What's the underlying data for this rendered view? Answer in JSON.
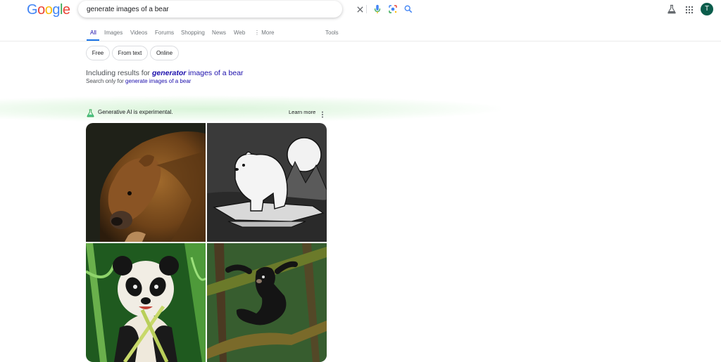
{
  "logo": {
    "letters": [
      "G",
      "o",
      "o",
      "g",
      "l",
      "e"
    ],
    "colors": [
      "#4285F4",
      "#EA4335",
      "#FBBC05",
      "#4285F4",
      "#34A853",
      "#EA4335"
    ]
  },
  "search": {
    "query": "generate images of a bear"
  },
  "header_icons": {
    "clear": "close-icon",
    "voice": "mic-icon",
    "lens": "lens-icon",
    "submit": "search-icon",
    "labs": "flask-icon",
    "apps": "apps-grid-icon"
  },
  "avatar": {
    "initial": "T",
    "color": "#0b5d4c"
  },
  "tabs": {
    "all": "All",
    "images": "Images",
    "videos": "Videos",
    "forums": "Forums",
    "shopping": "Shopping",
    "news": "News",
    "web": "Web",
    "more": "More",
    "tools": "Tools"
  },
  "chips": {
    "free": "Free",
    "from_text": "From text",
    "online": "Online"
  },
  "spelling": {
    "including_prefix": "Including results for",
    "corrected_word": "generator",
    "corrected_rest": "images of a bear",
    "search_only_prefix": "Search only for",
    "original_query": "generate images of a bear"
  },
  "ai_panel": {
    "notice": "Generative AI is experimental.",
    "learn_more": "Learn more",
    "images": [
      {
        "subject": "brown grizzly bear"
      },
      {
        "subject": "polar bear sketch on ice"
      },
      {
        "subject": "panda eating bamboo"
      },
      {
        "subject": "black bear hanging from branch"
      }
    ]
  },
  "colors": {
    "link": "#1a0dab",
    "accent": "#1a73e8",
    "muted": "#70757a"
  }
}
